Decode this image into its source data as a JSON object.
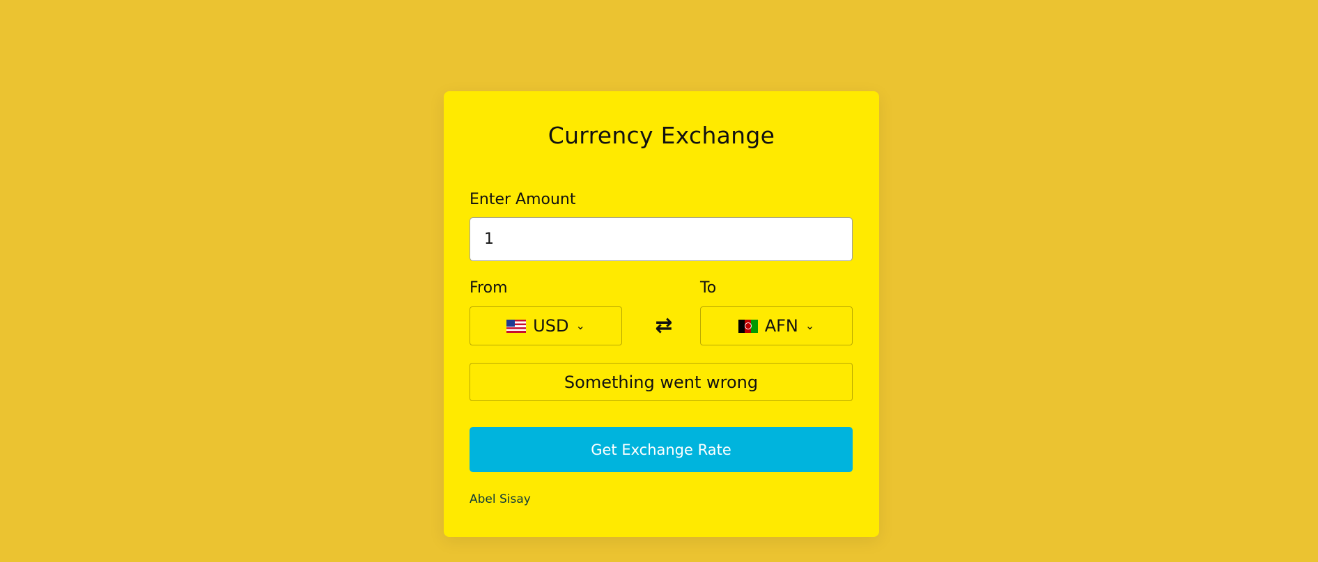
{
  "app": {
    "title": "Currency Exchange"
  },
  "amount": {
    "label": "Enter Amount",
    "value": "1"
  },
  "from": {
    "label": "From",
    "currency": "USD",
    "flag_icon": "us-flag-icon"
  },
  "to": {
    "label": "To",
    "currency": "AFN",
    "flag_icon": "af-flag-icon"
  },
  "swap": {
    "glyph": "⇄",
    "icon": "swap-arrows-icon"
  },
  "result": {
    "message": "Something went wrong"
  },
  "action": {
    "button_label": "Get Exchange Rate"
  },
  "footer": {
    "author": "Abel Sisay"
  },
  "colors": {
    "background": "#ebc331",
    "card": "#ffea00",
    "button": "#00b4dd"
  }
}
